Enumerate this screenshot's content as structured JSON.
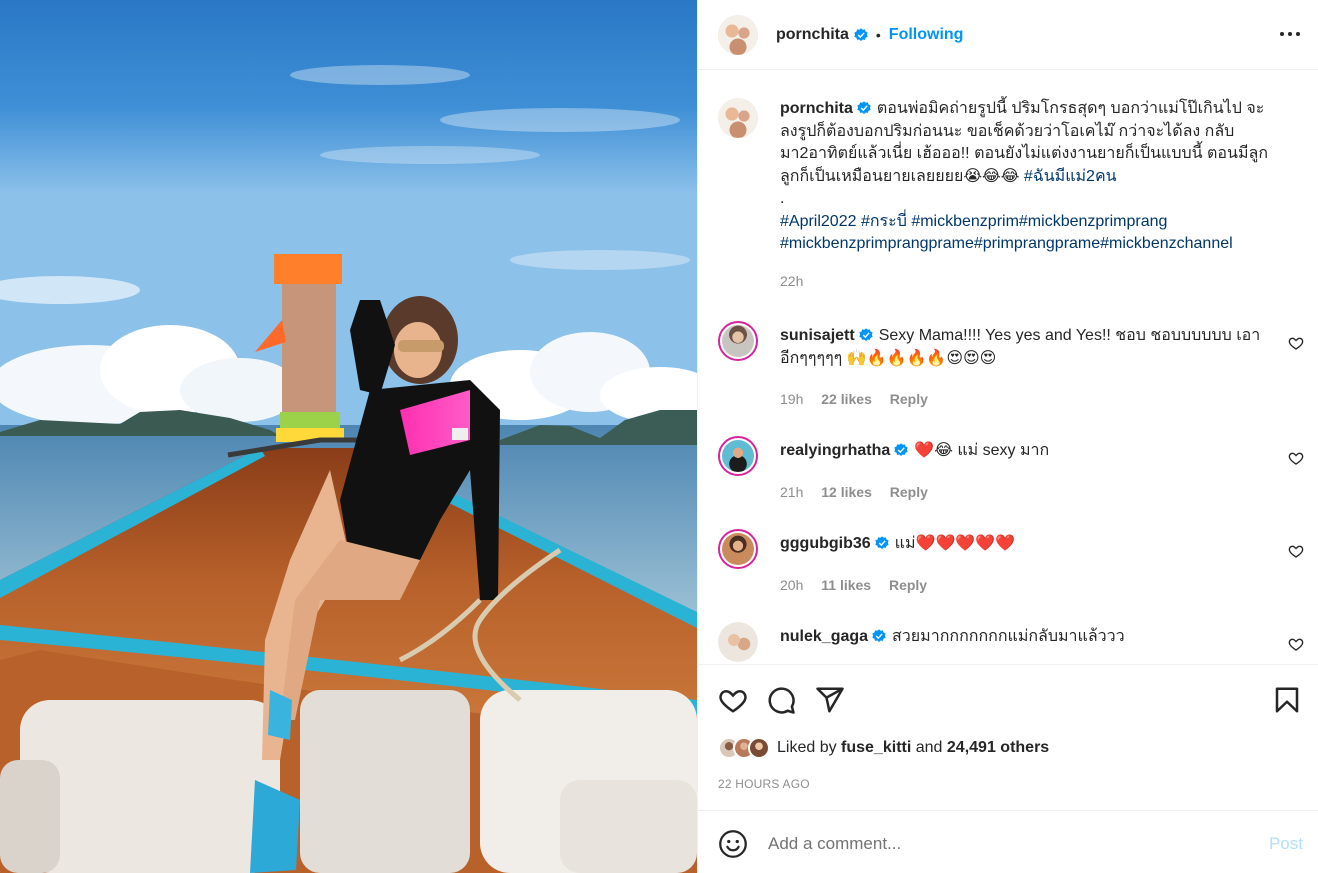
{
  "post_image": {
    "alt": "Woman in black swimsuit sitting on the bow of a longtail boat at sea"
  },
  "header": {
    "username": "pornchita",
    "separator": "•",
    "follow_status": "Following",
    "more_icon": "more-horizontal-icon"
  },
  "caption": {
    "username": "pornchita",
    "text": "ตอนพ่อมิคถ่ายรูปนี้ ปริมโกรธสุดๆ บอกว่าแม่โป๊เกินไป จะลงรูปก็ต้องบอกปริมก่อนนะ ขอเช็คด้วยว่าโอเคไม๊ กว่าจะได้ลง กลับมา2อาทิตย์แล้วเนี่ย เฮ้อออ!! ตอนยังไม่แต่งงานยายก็เป็นแบบนี้ ตอนมีลูก ลูกก็เป็นเหมือนยายเลยยยย😭😂😂",
    "hashtag_inline": "#ฉันมีแม่2คน",
    "dot": ".",
    "hashtags_line1": "#April2022 #กระบี่ #mickbenzprim#mickbenzprimprang",
    "hashtags_line2": "#mickbenzprimprangprame#primprangprame#mickbenzchannel",
    "time": "22h"
  },
  "comments": [
    {
      "username": "sunisajett",
      "text": "Sexy Mama!!!! Yes yes and Yes!! ชอบ ชอบบบบบบ เอาอีกๆๆๆๆๆ 🙌🔥🔥🔥🔥😍😍😍",
      "time": "19h",
      "likes": "22 likes",
      "reply": "Reply"
    },
    {
      "username": "realyingrhatha",
      "text": "❤️😂 แม่ sexy มาก",
      "time": "21h",
      "likes": "12 likes",
      "reply": "Reply"
    },
    {
      "username": "gggubgib36",
      "text": "แม่❤️❤️❤️❤️❤️",
      "time": "20h",
      "likes": "11 likes",
      "reply": "Reply"
    },
    {
      "username": "nulek_gaga",
      "text": "สวยมากกกกกกกแม่กลับมาแล้ววว"
    }
  ],
  "actions": {
    "like_icon": "heart-icon",
    "comment_icon": "comment-icon",
    "share_icon": "paper-plane-icon",
    "save_icon": "bookmark-icon"
  },
  "likes": {
    "prefix": "Liked by",
    "user": "fuse_kitti",
    "conj": "and",
    "others": "24,491 others"
  },
  "timestamp": "22 HOURS AGO",
  "add_comment": {
    "placeholder": "Add a comment...",
    "post_label": "Post"
  },
  "colors": {
    "link": "#0095f6",
    "tag": "#00376b",
    "muted": "#8e8e8e",
    "post_disabled": "#b2dffc",
    "like_red": "#ed4956"
  }
}
